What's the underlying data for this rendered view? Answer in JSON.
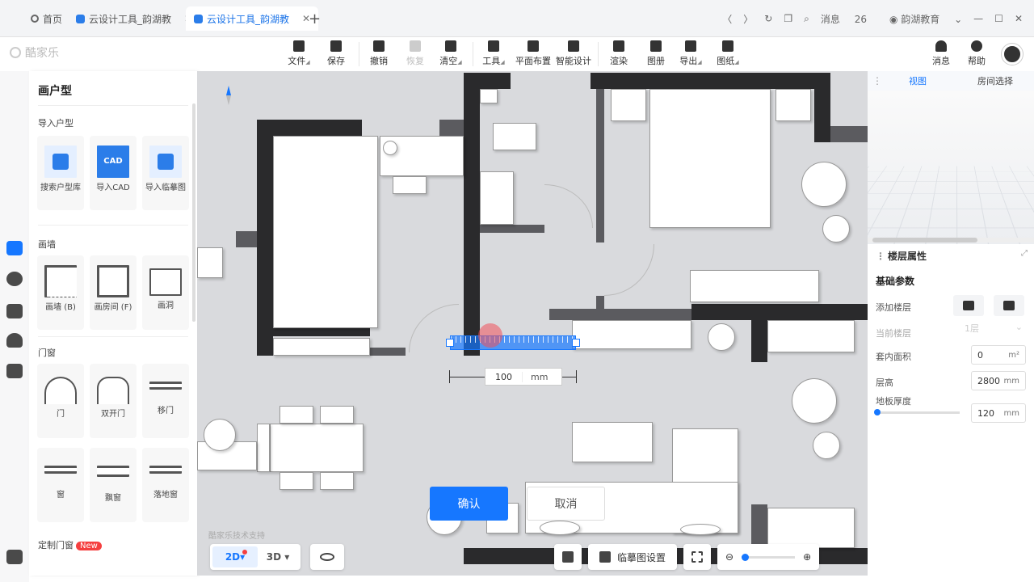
{
  "browser": {
    "tabs": [
      {
        "label": "首页"
      },
      {
        "label": "云设计工具_韵湖教"
      },
      {
        "label": "云设计工具_韵湖教"
      }
    ],
    "new_tab": "+",
    "message_label": "消息",
    "message_count": "26",
    "account": "韵湖教育"
  },
  "app": {
    "logo": "酷家乐",
    "toolbar": [
      {
        "label": "文件"
      },
      {
        "label": "保存"
      },
      {
        "label": "撤销"
      },
      {
        "label": "恢复"
      },
      {
        "label": "清空"
      },
      {
        "label": "工具"
      },
      {
        "label": "平面布置"
      },
      {
        "label": "智能设计"
      },
      {
        "label": "渲染"
      },
      {
        "label": "图册"
      },
      {
        "label": "导出"
      },
      {
        "label": "图纸"
      }
    ],
    "right_tools": [
      {
        "label": "消息"
      },
      {
        "label": "帮助"
      }
    ]
  },
  "left_panel": {
    "title": "画户型",
    "sections": {
      "import": {
        "title": "导入户型",
        "items": [
          "搜索户型库",
          "导入CAD",
          "导入临摹图"
        ],
        "cad_badge": "CAD"
      },
      "walls": {
        "title": "画墙",
        "items": [
          "画墙 (B)",
          "画房间 (F)",
          "画洞"
        ]
      },
      "doors": {
        "title": "门窗",
        "items": [
          "门",
          "双开门",
          "移门",
          "窗",
          "飘窗",
          "落地窗"
        ]
      },
      "custom": {
        "title": "定制门窗",
        "badge": "New"
      }
    }
  },
  "canvas": {
    "dimension_value": "100",
    "dimension_unit": "mm",
    "confirm": "确认",
    "cancel": "取消",
    "watermark": "酷家乐技术支持",
    "view_2d": "2D",
    "view_3d": "3D",
    "trace_settings": "临摹图设置"
  },
  "right_panel": {
    "tabs": [
      "视图",
      "房间选择"
    ],
    "section_title": "楼层属性",
    "subtitle": "基础参数",
    "add_floor": "添加楼层",
    "current_floor": "当前楼层",
    "current_floor_value": "1层",
    "inner_area": "套内面积",
    "inner_area_value": "0",
    "inner_area_unit": "m²",
    "floor_height": "层高",
    "floor_height_value": "2800",
    "floor_height_unit": "mm",
    "floor_thickness": "地板厚度",
    "floor_thickness_value": "120",
    "floor_thickness_unit": "mm",
    "floor_thickness_fraction": 0.05
  }
}
